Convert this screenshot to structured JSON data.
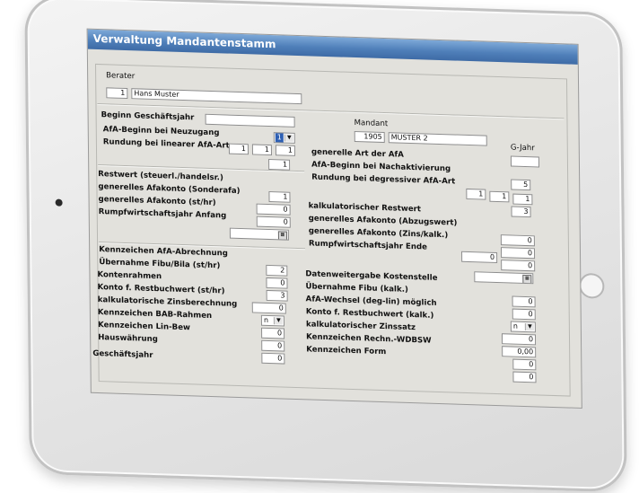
{
  "window": {
    "title": "Verwaltung Mandantenstamm"
  },
  "berater": {
    "label": "Berater",
    "number": "1",
    "name": "Hans Muster"
  },
  "mandant": {
    "label": "Mandant",
    "number": "1905",
    "name": "MUSTER 2"
  },
  "gjahr": {
    "label": "G-Jahr",
    "value": ""
  },
  "left": {
    "beginn_label": "Beginn Geschäftsjahr",
    "beginn_value": "",
    "afa_beginn_label": "AfA-Beginn bei Neuzugang",
    "afa_beginn_value": "1",
    "rundung_linear_label": "Rundung bei linearer AfA-Art",
    "rundung_linear_values": [
      "1",
      "1",
      "1"
    ],
    "rundung_extra_value": "1"
  },
  "right": {
    "generelle_afa_art_label": "generelle Art der AfA",
    "afa_beginn_nachakt_label": "AfA-Beginn bei Nachaktivierung",
    "rundung_degr_label": "Rundung bei degressiver AfA-Art",
    "generelle_afa_art_value": "5",
    "rundung_degr_values": [
      "1",
      "1",
      "1"
    ],
    "rundung_degr_extra_value": "3"
  },
  "restwert": {
    "label": "Restwert (steuerl./handelsr.)",
    "afakonto_sonderafa_label": "generelles Afakonto (Sonderafa)",
    "afakonto_sonderafa_value": "1",
    "afakonto_sthr_label": "generelles Afakonto (st/hr)",
    "afakonto_sthr_value": "0",
    "rumpf_anfang_label": "Rumpfwirtschaftsjahr Anfang",
    "rumpf_anfang_value": "0",
    "rumpf_anfang_date": ""
  },
  "kalk": {
    "label": "kalkulatorischer Restwert",
    "abzugswert_label": "generelles Afakonto (Abzugswert)",
    "abzugswert_value": "0",
    "zins_label": "generelles Afakonto (Zins/kalk.)",
    "zins_value": "0",
    "rumpf_ende_label": "Rumpfwirtschaftsjahr Ende",
    "rumpf_ende_value": "0",
    "rumpf_ende_value2": "0",
    "rumpf_ende_date": ""
  },
  "lower_left": {
    "kennzeichen_afa_label": "Kennzeichen AfA-Abrechnung",
    "uebernahme_label": "Übernahme Fibu/Bila (st/hr)",
    "uebernahme_value": "2",
    "kontenrahmen_label": "Kontenrahmen",
    "kontenrahmen_value": "0",
    "konto_restbuch_label": "Konto f. Restbuchwert (st/hr)",
    "konto_restbuch_value": "3",
    "zinsberechnung_label": "kalkulatorische Zinsberechnung",
    "zinsberechnung_value": "0",
    "bab_label": "Kennzeichen BAB-Rahmen",
    "bab_value": "n",
    "linbew_label": "Kennzeichen Lin-Bew",
    "linbew_value": "0",
    "hauswaehrung_label": "Hauswährung",
    "hauswaehrung_value": "0",
    "geschaeftsjahr_label": "Geschäftsjahr",
    "geschaeftsjahr_value": "0"
  },
  "lower_right": {
    "datenweitergabe_label": "Datenweitergabe Kostenstelle",
    "uebernahme_kalk_label": "Übernahme Fibu (kalk.)",
    "uebernahme_kalk_value": "0",
    "afa_wechsel_label": "AfA-Wechsel (deg-lin) möglich",
    "afa_wechsel_value": "0",
    "konto_restbuch_kalk_label": "Konto f. Restbuchwert (kalk.)",
    "konto_restbuch_kalk_value": "n",
    "zinssatz_label": "kalkulatorischer Zinssatz",
    "zinssatz_value": "0",
    "wdbsw_label": "Kennzeichen Rechn.-WDBSW",
    "wdbsw_value": "0,00",
    "form_label": "Kennzeichen Form",
    "form_value": "0",
    "extra_value": "0"
  }
}
